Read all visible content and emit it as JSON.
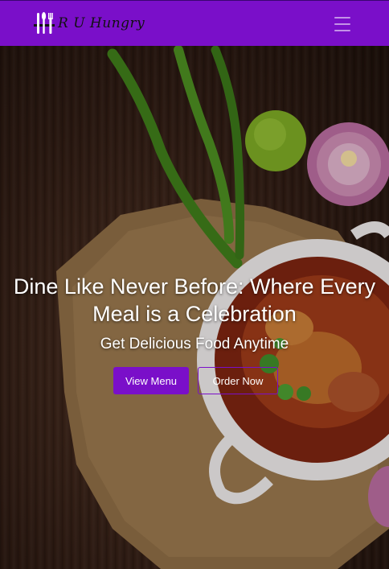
{
  "brand": {
    "name": "R U Hungry",
    "icon": "cutlery-logo-icon"
  },
  "navbar": {
    "toggle_icon": "hamburger-menu-icon",
    "color": "#7a0fc9"
  },
  "hero": {
    "title": "Dine Like Never Before: Where Every Meal is a Celebration",
    "subtitle": "Get Delicious Food Anytime",
    "primary_button": "View Menu",
    "secondary_button": "Order Now"
  }
}
